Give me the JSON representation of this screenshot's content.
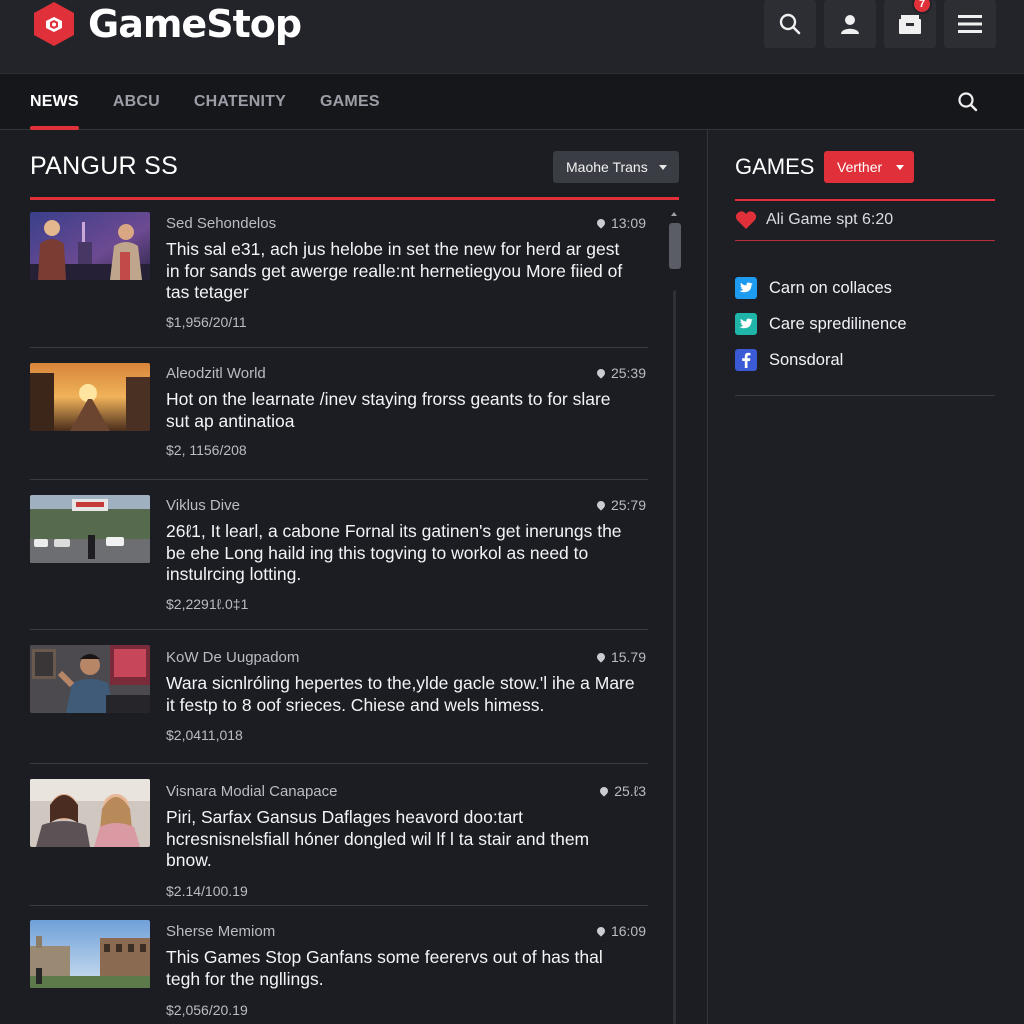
{
  "brand": {
    "name": "GameStop",
    "accent": "#e0313b"
  },
  "header": {
    "badge_count": "7"
  },
  "nav": {
    "tabs": [
      "NEWS",
      "ABCU",
      "CHATENITY",
      "GAMES"
    ],
    "active": "NEWS"
  },
  "main": {
    "title": "PANGUR SS",
    "sort_dropdown": "Maohe Trans",
    "articles": [
      {
        "source": "Sed Sehondelos",
        "time": "13:09",
        "text": "This sal e31, ach jus helobe in set the new for herd ar gest in for sands get awerge realle:nt hernetiegyou More fiied of tas tetager",
        "meta": "$1,956/20/11",
        "thumb": "city-night-girls"
      },
      {
        "source": "Aleodzitl World",
        "time": "25:39",
        "text": "Hot on the learnate /inev staying frorss geants to for slare sut ap antinatioa",
        "meta": "$2, 1156/208",
        "thumb": "sunset-street"
      },
      {
        "source": "Viklus Dive",
        "time": "25:79",
        "text": "26ℓ1, It learl, a cabone Fornal its gatinen's get inerungs the be ehe Long haild ing this togving to workol as need to instulrcing lotting.",
        "meta": "$2,2291ℓ.0‡1",
        "thumb": "parking-lot"
      },
      {
        "source": "KoW De Uugpadom",
        "time": "15.79",
        "text": "Wara sicnlróling hepertes to the,ylde gacle stow.'l ihe a Mare it festp to 8 oof srieces. Chiese and wels himess.",
        "meta": "$2,0411,018",
        "thumb": "gamer-room"
      },
      {
        "source": "Visnara Modial Canapace",
        "time": "25.ℓ3",
        "text": "Piri, Sarfax Gansus Daflages heavord doo:tart hcresnisnelsfiall hóner dongled wil lf l ta stair and them bnow.",
        "meta": "$2.14/100.19",
        "thumb": "two-women"
      },
      {
        "source": "Sherse Memiom",
        "time": "16:09",
        "text": "This Games Stop Ganfans some feerervs out of has thal tegh for the ngllings.",
        "meta": "$2,056/20.19",
        "thumb": "old-town"
      }
    ]
  },
  "sidebar": {
    "title": "GAMES",
    "button": "Verther",
    "featured": "Ali Game spt 6:20",
    "links": [
      {
        "label": "Carn on collaces",
        "icon": "twitter-icon",
        "color": "#1d9bf0"
      },
      {
        "label": "Care spredilinence",
        "icon": "twitter-icon",
        "color": "#1fb5a8"
      },
      {
        "label": "Sonsdoral",
        "icon": "facebook-icon",
        "color": "#3b5bd6"
      }
    ]
  }
}
